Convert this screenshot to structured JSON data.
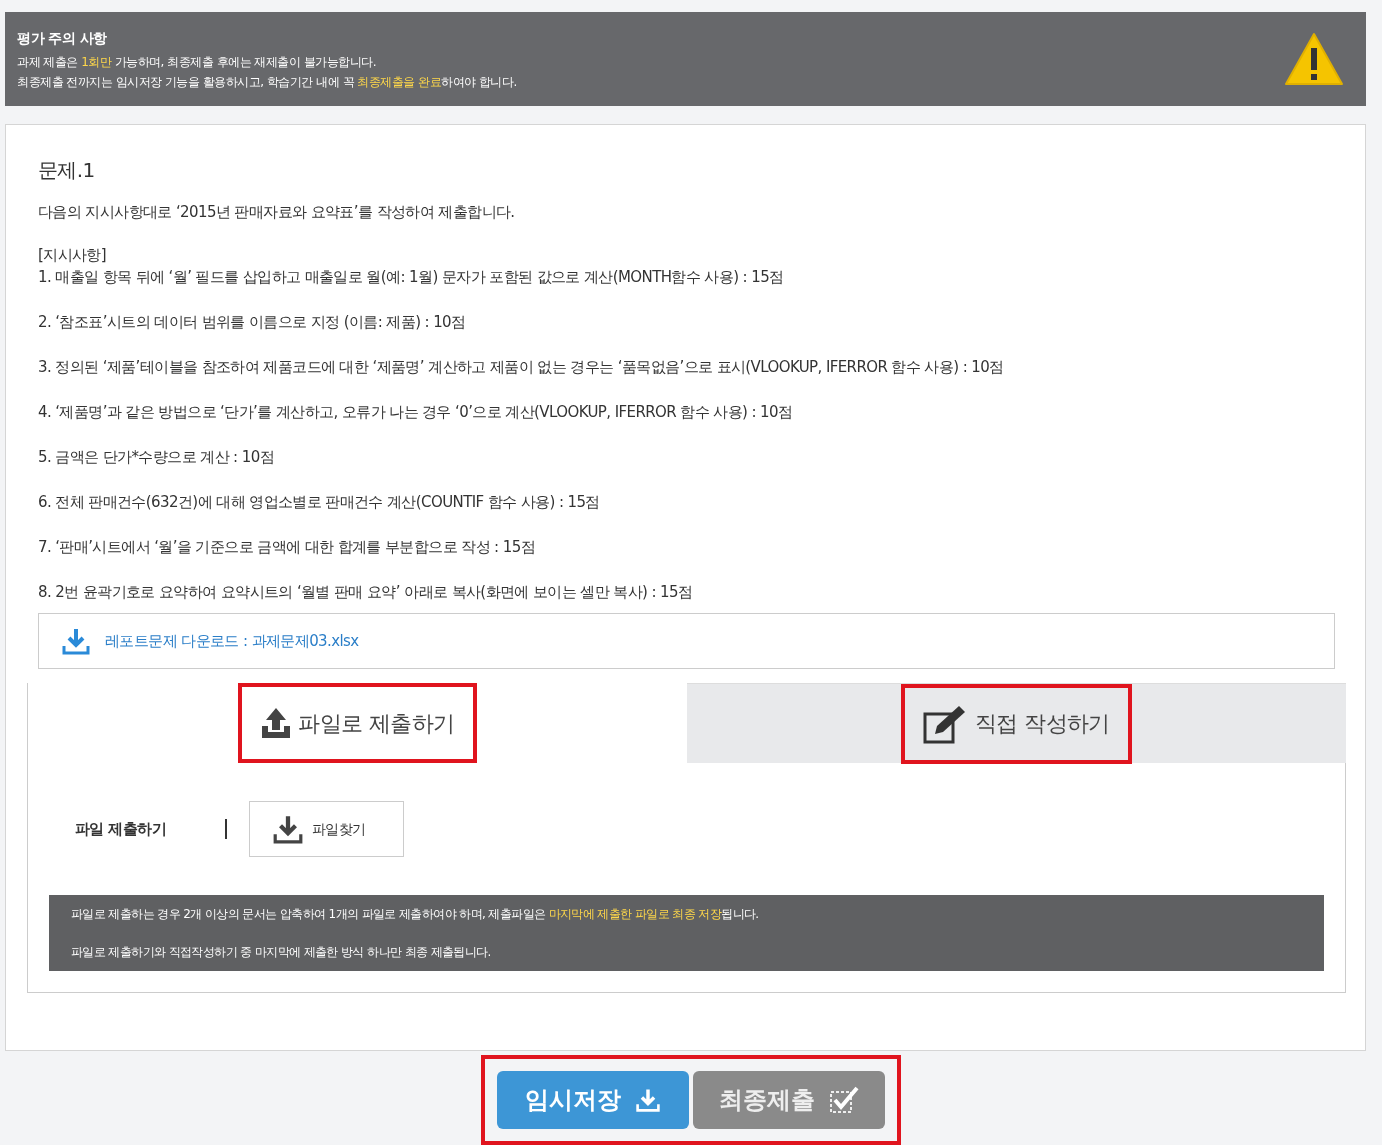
{
  "notice": {
    "title": "평가 주의 사항",
    "lines": [
      [
        {
          "text": "과제 제출은 ",
          "highlight": false
        },
        {
          "text": "1회만",
          "highlight": true
        },
        {
          "text": " 가능하며, 최종제출 후에는 재제출이 불가능합니다.",
          "highlight": false
        }
      ],
      [
        {
          "text": "최종제출 전까지는 임시저장 기능을 활용하시고, 학습기간 내에 꼭 ",
          "highlight": false
        },
        {
          "text": "최종제출을 완료",
          "highlight": true
        },
        {
          "text": "하여야 합니다.",
          "highlight": false
        }
      ]
    ]
  },
  "question": {
    "title": "문제.1",
    "intro": "다음의 지시사항대로 ‘2015년 판매자료와 요약표’를 작성하여 제출합니다.",
    "instructions_heading": "[지시사항]",
    "instructions": [
      "1. 매출일 항목 뒤에 ‘월’ 필드를 삽입하고 매출일로 월(예: 1월) 문자가 포함된 값으로 계산(MONTH함수 사용) : 15점",
      "2. ‘참조표’시트의 데이터 범위를 이름으로 지정 (이름: 제품) : 10점",
      "3. 정의된 ‘제품’테이블을 참조하여 제품코드에 대한 ‘제품명’ 계산하고 제품이 없는 경우는 ‘품목없음’으로 표시(VLOOKUP, IFERROR 함수 사용) : 10점",
      "4. ‘제품명’과 같은 방법으로 ‘단가’를 계산하고, 오류가 나는 경우 ‘0’으로 계산(VLOOKUP, IFERROR 함수 사용) : 10점",
      "5. 금액은 단가*수량으로 계산 : 10점",
      "6. 전체 판매건수(632건)에 대해 영업소별로 판매건수 계산(COUNTIF 함수 사용) : 15점",
      "7. ‘판매’시트에서 ‘월’을 기준으로 금액에 대한 합계를 부분합으로 작성 : 15점",
      "8. 2번 윤곽기호로 요약하여 요약시트의 ‘월별 판매 요약’ 아래로 복사(화면에 보이는 셀만 복사) : 15점"
    ],
    "download": "레포트문제 다운로드 : 과제문제03.xlsx"
  },
  "tabs": [
    {
      "label": "파일로 제출하기",
      "kind": "upload",
      "selected": true,
      "highlighted": true
    },
    {
      "label": "직접 작성하기",
      "kind": "write",
      "selected": false,
      "highlighted": true
    }
  ],
  "file_submit": {
    "label": "파일 제출하기",
    "button": "파일찾기"
  },
  "info_lines": [
    [
      {
        "text": "파일로 제출하는 경우 2개 이상의 문서는 압축하여 1개의 파일로 제출하여야 하며, 제출파일은 ",
        "highlight": false
      },
      {
        "text": "마지막에 제출한 파일로 최종 저장",
        "highlight": true
      },
      {
        "text": "됩니다.",
        "highlight": false
      }
    ],
    [
      {
        "text": "파일로 제출하기와 직접작성하기 중 마지막에 제출한 방식 하나만 최종 제출됩니다.",
        "highlight": false
      }
    ]
  ],
  "actions": {
    "highlighted": true,
    "buttons": [
      {
        "label": "임시저장",
        "kind": "save"
      },
      {
        "label": "최종제출",
        "kind": "submit"
      }
    ]
  }
}
